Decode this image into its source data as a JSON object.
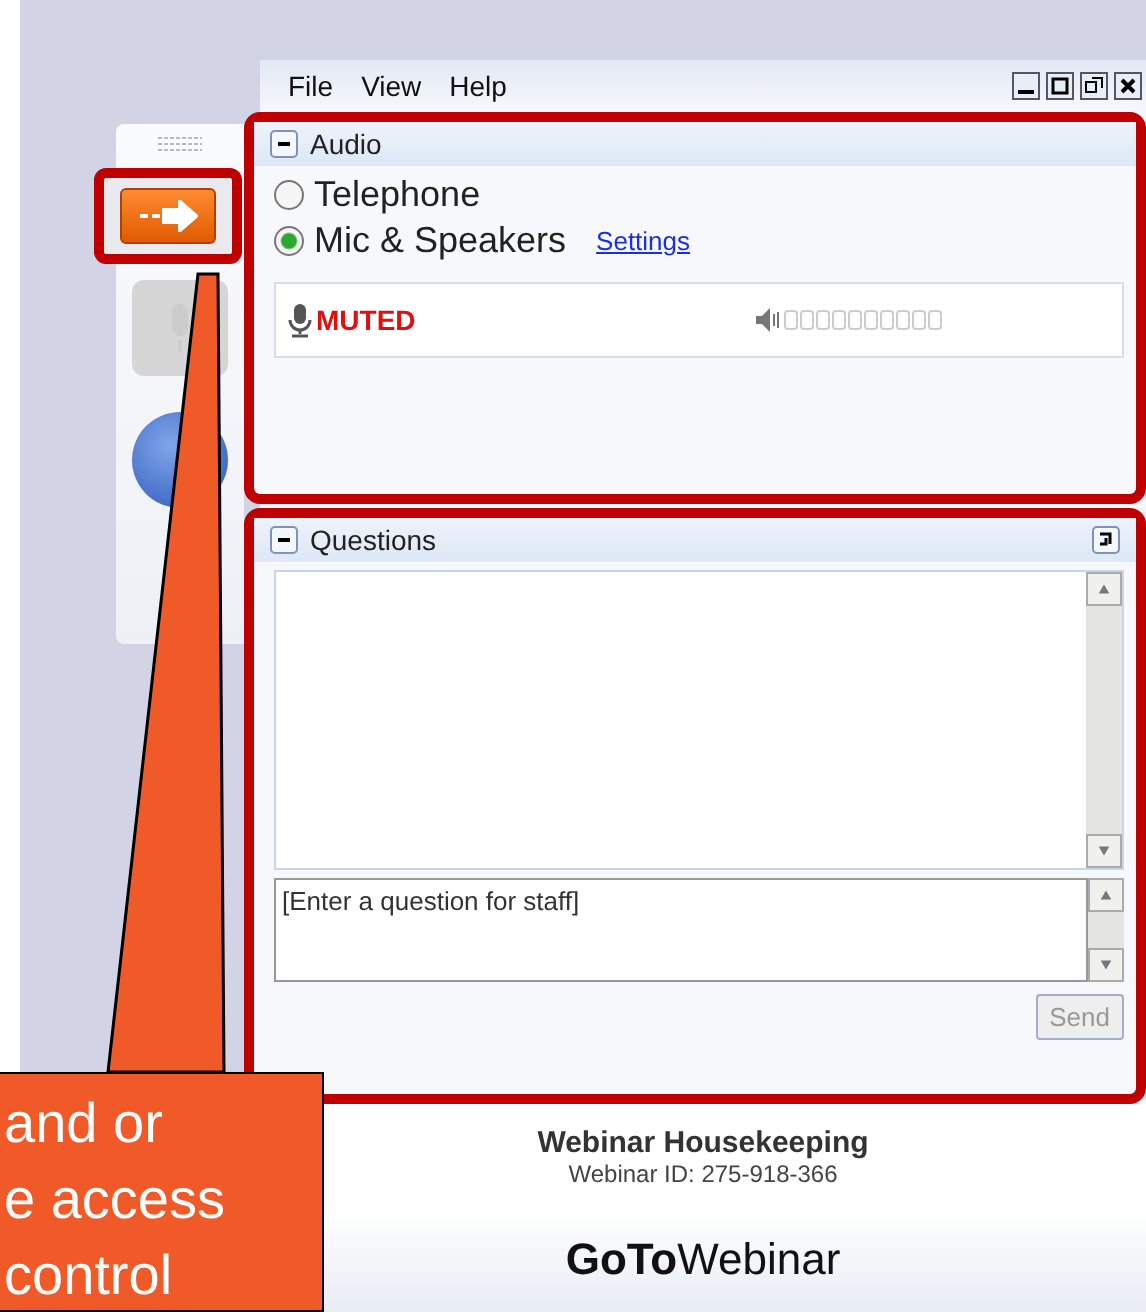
{
  "menu": [
    "File",
    "View",
    "Help"
  ],
  "audio": {
    "title": "Audio",
    "options": [
      {
        "label": "Telephone",
        "selected": false
      },
      {
        "label": "Mic & Speakers",
        "selected": true
      }
    ],
    "settings_link": "Settings",
    "mic_status": "MUTED"
  },
  "questions": {
    "title": "Questions",
    "placeholder": "[Enter a question for staff]",
    "send": "Send",
    "send_disabled": true
  },
  "footer": {
    "title": "Webinar Housekeeping",
    "webinar_id": "Webinar ID: 275-918-366"
  },
  "logo": "**GoTo**Webinar",
  "callout": {
    "lines": [
      "and or",
      "e access",
      "control"
    ]
  }
}
